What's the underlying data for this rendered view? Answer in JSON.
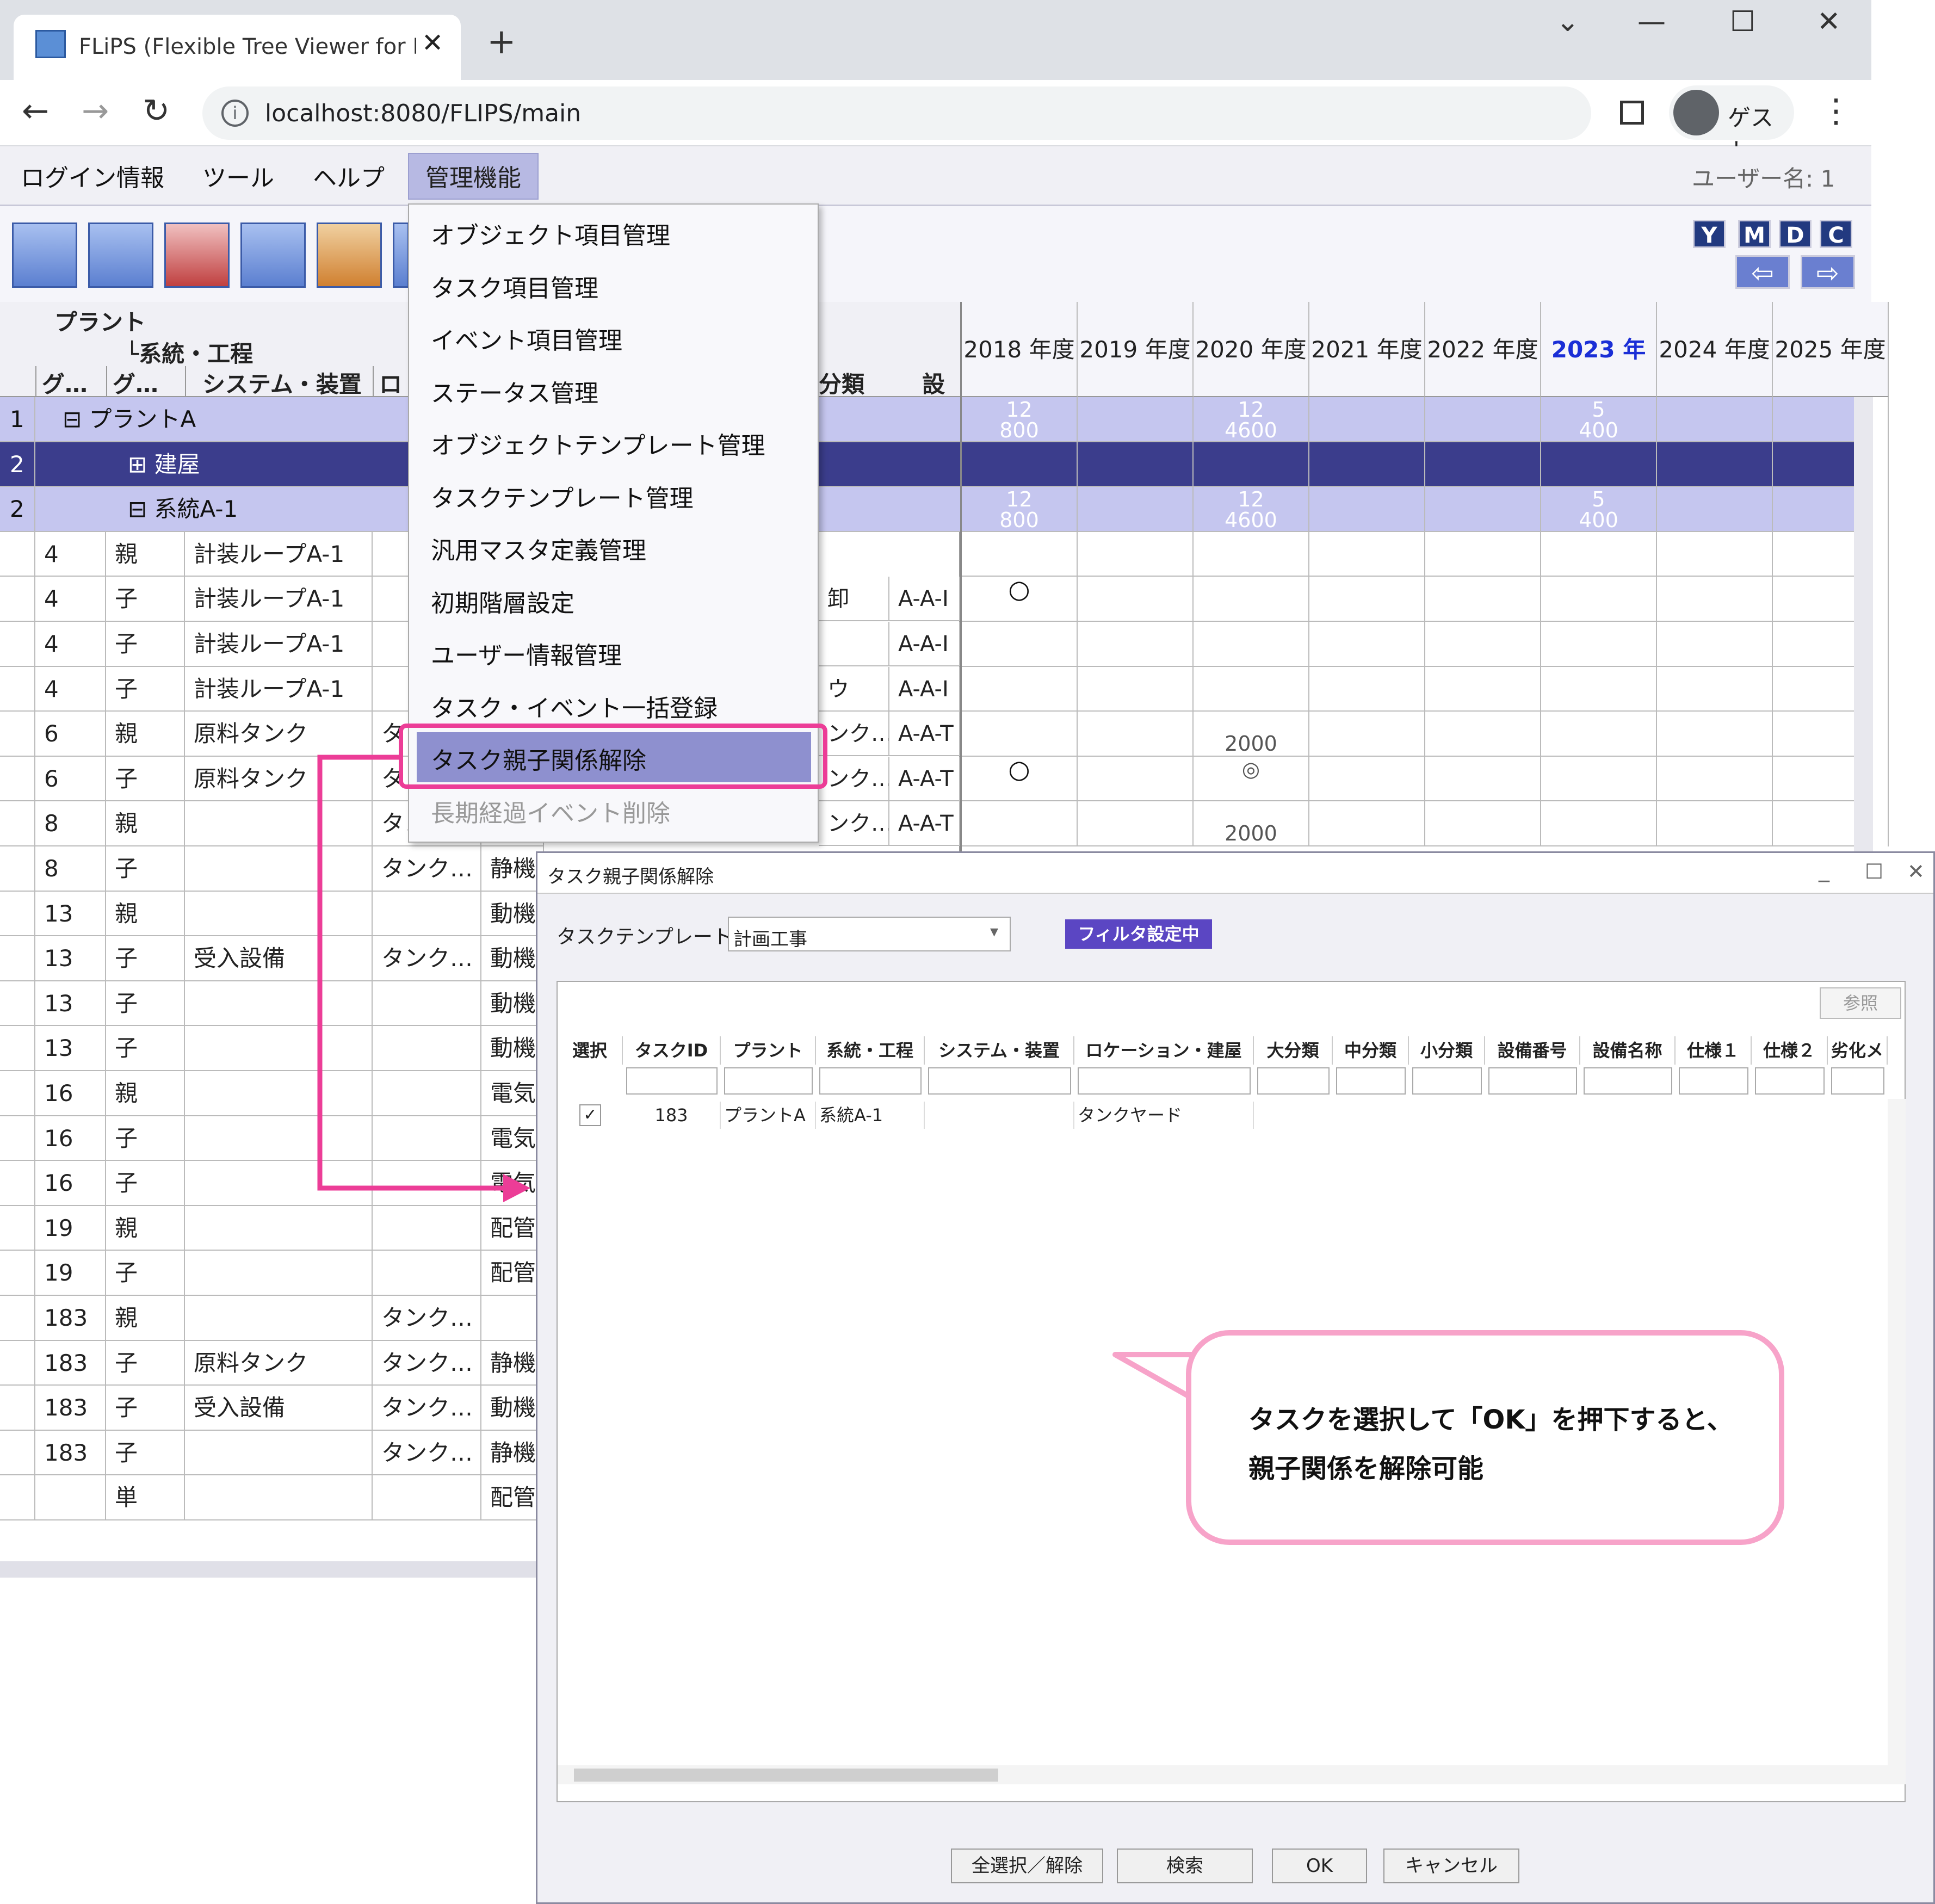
{
  "browser": {
    "tab_title": "FLiPS (Flexible Tree Viewer for Pla",
    "url": "localhost:8080/FLIPS/main",
    "profile_label": "ゲスト"
  },
  "menubar": {
    "items": [
      "ログイン情報",
      "ツール",
      "ヘルプ",
      "管理機能"
    ],
    "user_label": "ユーザー名: 1"
  },
  "toolbar": {
    "view_buttons": [
      "Y",
      "M",
      "D",
      "C"
    ],
    "prev": "⇦",
    "next": "⇨"
  },
  "dropdown": {
    "items": [
      "オブジェクト項目管理",
      "タスク項目管理",
      "イベント項目管理",
      "ステータス管理",
      "オブジェクトテンプレート管理",
      "タスクテンプレート管理",
      "汎用マスタ定義管理",
      "初期階層設定",
      "ユーザー情報管理",
      "タスク・イベント一括登録",
      "タスク親子関係解除",
      "長期経過イベント削除"
    ]
  },
  "grid": {
    "h1": "プラント",
    "h2": "└系統・工程",
    "cols": [
      "グ…",
      "グ…",
      "システム・装置",
      "ロケ"
    ],
    "extra_cols": [
      "分類",
      "設"
    ],
    "group_rows": [
      {
        "num": "1",
        "label": "⊟ プラントA"
      },
      {
        "num": "2",
        "label": "⊞ 建屋"
      },
      {
        "num": "2",
        "label": "⊟ 系統A-1"
      }
    ],
    "rows": [
      [
        "4",
        "親",
        "計装ループA-1",
        "",
        ""
      ],
      [
        "4",
        "子",
        "計装ループA-1",
        "",
        ""
      ],
      [
        "4",
        "子",
        "計装ループA-1",
        "",
        ""
      ],
      [
        "4",
        "子",
        "計装ループA-1",
        "",
        ""
      ],
      [
        "6",
        "親",
        "原料タンク",
        "タ",
        ""
      ],
      [
        "6",
        "子",
        "原料タンク",
        "タ",
        ""
      ],
      [
        "8",
        "親",
        "",
        "タン",
        ""
      ],
      [
        "8",
        "子",
        "",
        "タンク…",
        "静機"
      ],
      [
        "13",
        "親",
        "",
        "",
        "動機"
      ],
      [
        "13",
        "子",
        "受入設備",
        "タンク…",
        "動機"
      ],
      [
        "13",
        "子",
        "",
        "",
        "動機"
      ],
      [
        "13",
        "子",
        "",
        "",
        "動機"
      ],
      [
        "16",
        "親",
        "",
        "",
        "電気"
      ],
      [
        "16",
        "子",
        "",
        "",
        "電気"
      ],
      [
        "16",
        "子",
        "",
        "",
        "電気"
      ],
      [
        "19",
        "親",
        "",
        "",
        "配管"
      ],
      [
        "19",
        "子",
        "",
        "",
        "配管"
      ],
      [
        "183",
        "親",
        "",
        "タンク…",
        ""
      ],
      [
        "183",
        "子",
        "原料タンク",
        "タンク…",
        "静機"
      ],
      [
        "183",
        "子",
        "受入設備",
        "タンク…",
        "動機"
      ],
      [
        "183",
        "子",
        "",
        "タンク…",
        "静機"
      ],
      [
        "",
        "単",
        "",
        "",
        "配管"
      ]
    ],
    "side_cells": [
      [
        "卸",
        "A-A-I"
      ],
      [
        "",
        "A-A-I"
      ],
      [
        "ウ",
        "A-A-I"
      ],
      [
        "ンク…",
        "A-A-T"
      ],
      [
        "ンク…",
        "A-A-T"
      ],
      [
        "ンク…",
        "A-A-T"
      ]
    ]
  },
  "years": [
    "2018 年度",
    "2019 年度",
    "2020 年度",
    "2021 年度",
    "2022 年度",
    "2023 年度",
    "2024 年度",
    "2025 年度"
  ],
  "year_values": {
    "r1": [
      "12\n800",
      "",
      "12\n4600",
      "",
      "",
      "5\n400",
      "",
      ""
    ],
    "r3": [
      "12\n800",
      "",
      "12\n4600",
      "",
      "",
      "5\n400",
      "",
      ""
    ]
  },
  "marks": {
    "mark_2000a": "2000",
    "mark_2000b": "2000",
    "dash": "-",
    "circle": "○",
    "double": "◎"
  },
  "dialog": {
    "title": "タスク親子関係解除",
    "template_label": "タスクテンプレート",
    "template_value": "計画工事",
    "filter_badge": "フィルタ設定中",
    "ref_button": "参照",
    "columns": [
      "選択",
      "タスクID",
      "プラント",
      "系統・工程",
      "システム・装置",
      "ロケーション・建屋",
      "大分類",
      "中分類",
      "小分類",
      "設備番号",
      "設備名称",
      "仕様１",
      "仕様２",
      "劣化メ"
    ],
    "row": {
      "checked": "✓",
      "task_id": "183",
      "plant": "プラントA",
      "system": "系統A-1",
      "location": "タンクヤード"
    },
    "buttons": [
      "全選択／解除",
      "検索",
      "OK",
      "キャンセル"
    ]
  },
  "callout": {
    "line1": "タスクを選択して「OK」を押下すると、",
    "line2": "親子関係を解除可能"
  },
  "colors": {
    "highlight": "#ec3d97",
    "bubble_border": "#f7a3c9",
    "group_bg": "#c5c6ef",
    "group_dark": "#3b3d8c",
    "year_2023": "#1a2ed6"
  }
}
